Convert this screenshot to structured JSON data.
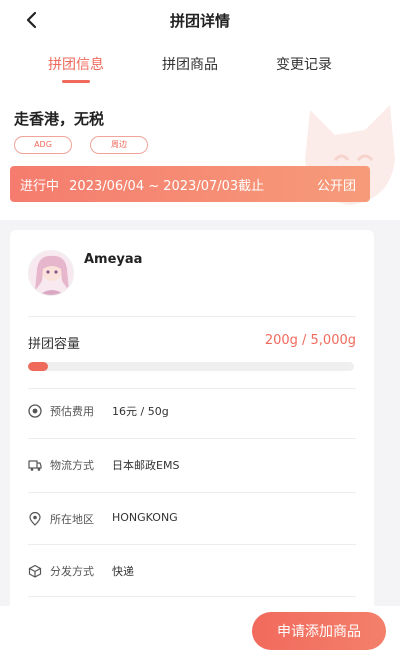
{
  "header": {
    "title": "拼团详情"
  },
  "tabs": [
    {
      "label": "拼团信息",
      "active": true
    },
    {
      "label": "拼团商品",
      "active": false
    },
    {
      "label": "变更记录",
      "active": false
    }
  ],
  "group": {
    "name": "走香港，无税",
    "tags": [
      "ADG",
      "周边"
    ],
    "status": "进行中",
    "period": "2023/06/04 ~ 2023/07/03截止",
    "type": "公开团"
  },
  "organizer": {
    "name": "Ameyaa"
  },
  "capacity": {
    "label": "拼团容量",
    "value": "200g / 5,000g",
    "progress_fraction": 0.06
  },
  "details": [
    {
      "icon": "coin-icon",
      "label": "预估费用",
      "value": "16元 / 50g"
    },
    {
      "icon": "truck-icon",
      "label": "物流方式",
      "value": "日本邮政EMS"
    },
    {
      "icon": "location-pin-icon",
      "label": "所在地区",
      "value": "HONGKONG"
    },
    {
      "icon": "package-icon",
      "label": "分发方式",
      "value": "快递"
    }
  ],
  "actions": {
    "apply_label": "申请添加商品"
  },
  "colors": {
    "accent": "#f06a5c",
    "banner_start": "#f57c6e",
    "banner_end": "#f69b7a"
  }
}
